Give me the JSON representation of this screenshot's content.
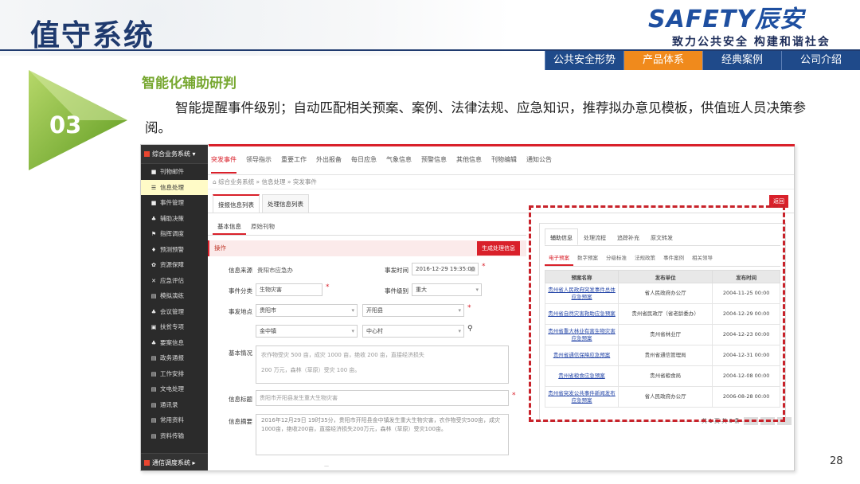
{
  "slide": {
    "title": "值守系统",
    "page_number": "28",
    "logo": {
      "main": "SAFETY辰安",
      "slogan": "致力公共安全 构建和谐社会"
    },
    "nav": [
      {
        "label": "公共安全形势",
        "active": false
      },
      {
        "label": "产品体系",
        "active": true
      },
      {
        "label": "经典案例",
        "active": false
      },
      {
        "label": "公司介绍",
        "active": false
      }
    ],
    "section_number": "03",
    "section_title": "智能化辅助研判",
    "section_desc": "智能提醒事件级别；自动匹配相关预案、案例、法律法规、应急知识，推荐拟办意见模板，供值班人员决策参阅。"
  },
  "app": {
    "sidebar": {
      "header": "综合业务系统",
      "footer": "通信调度系统",
      "items": [
        {
          "icon": "■",
          "label": "刊物邮件",
          "active": false
        },
        {
          "icon": "☰",
          "label": "信息处理",
          "active": true
        },
        {
          "icon": "■",
          "label": "事件管理",
          "active": false
        },
        {
          "icon": "♣",
          "label": "辅助决策",
          "active": false
        },
        {
          "icon": "⚑",
          "label": "指挥调度",
          "active": false
        },
        {
          "icon": "♦",
          "label": "预测预警",
          "active": false
        },
        {
          "icon": "✿",
          "label": "资源保障",
          "active": false
        },
        {
          "icon": "✕",
          "label": "应急评估",
          "active": false
        },
        {
          "icon": "▤",
          "label": "模拟演练",
          "active": false
        },
        {
          "icon": "♣",
          "label": "会议管理",
          "active": false
        },
        {
          "icon": "▣",
          "label": "扶贫专项",
          "active": false
        },
        {
          "icon": "♣",
          "label": "要案信息",
          "active": false
        },
        {
          "icon": "▤",
          "label": "政务通报",
          "active": false
        },
        {
          "icon": "▤",
          "label": "工作安排",
          "active": false
        },
        {
          "icon": "▤",
          "label": "文电处理",
          "active": false
        },
        {
          "icon": "▤",
          "label": "通讯录",
          "active": false
        },
        {
          "icon": "▤",
          "label": "常用资料",
          "active": false
        },
        {
          "icon": "▤",
          "label": "资料传输",
          "active": false
        }
      ]
    },
    "main_tabs": [
      {
        "label": "突发事件",
        "active": true
      },
      {
        "label": "领导指示",
        "active": false
      },
      {
        "label": "重要工作",
        "active": false
      },
      {
        "label": "外出报备",
        "active": false
      },
      {
        "label": "每日应急",
        "active": false
      },
      {
        "label": "气象信息",
        "active": false
      },
      {
        "label": "预警信息",
        "active": false
      },
      {
        "label": "其他信息",
        "active": false
      },
      {
        "label": "刊物编辑",
        "active": false
      },
      {
        "label": "通知公告",
        "active": false
      }
    ],
    "breadcrumb": "综合业务系统 » 信息处理 » 突发事件",
    "subtabs": [
      {
        "label": "接报信息列表",
        "active": true
      },
      {
        "label": "处理信息列表",
        "active": false
      }
    ],
    "return_btn": "返回",
    "info_tabs": [
      {
        "label": "基本信息",
        "active": true
      },
      {
        "label": "原始刊物",
        "active": false
      }
    ],
    "op_label": "操作",
    "generate_btn": "生成处理信息",
    "form": {
      "source_label": "信息来源",
      "source_value": "贵阳市应急办",
      "time_label": "事发时间",
      "time_value": "2016-12-29 19:35:00",
      "category_label": "事件分类",
      "category_value": "生物灾害",
      "level_label": "事件级别",
      "level_value": "重大",
      "location_label": "事发地点",
      "city": "贵阳市",
      "county": "开阳县",
      "town": "金中镇",
      "village": "中心村",
      "situation_label": "基本情况",
      "situation_line1": "农作物受灾 500 亩，成灾 1000 亩，绝收 200 亩，直接经济损失",
      "situation_line2": "200 万元，森林（草原）受灾 100 亩。",
      "title_label": "信息标题",
      "title_value": "贵阳市开阳县发生重大生物灾害",
      "summary_label": "信息摘要",
      "summary_value": "2016年12月29日 19时35分，贵阳市开阳县金中镇发生重大生物灾害，农作物受灾500亩，成灾1000亩，绝收200亩，直接经济损失200万元，森林（草原）受灾100亩。"
    },
    "right": {
      "tabs": [
        {
          "label": "辅助信息",
          "active": true
        },
        {
          "label": "处理流程",
          "active": false
        },
        {
          "label": "追踪补充",
          "active": false
        },
        {
          "label": "原文转发",
          "active": false
        }
      ],
      "subtabs": [
        {
          "label": "电子预案",
          "active": true
        },
        {
          "label": "数字预案",
          "active": false
        },
        {
          "label": "分级标准",
          "active": false
        },
        {
          "label": "法规政策",
          "active": false
        },
        {
          "label": "事件案例",
          "active": false
        },
        {
          "label": "相关领导",
          "active": false
        }
      ],
      "headers": [
        "预案名称",
        "发布单位",
        "发布时间"
      ],
      "rows": [
        {
          "name": "贵州省人民政府突发事件总体应急预案",
          "org": "省人民政府办公厅",
          "date": "2004-11-25 00:00"
        },
        {
          "name": "贵州省自然灾害救助应急预案",
          "org": "贵州省民政厅（省老龄委办）",
          "date": "2004-12-29 00:00"
        },
        {
          "name": "贵州省重大林业有害生物灾害应急预案",
          "org": "贵州省林业厅",
          "date": "2004-12-23 00:00"
        },
        {
          "name": "贵州省通信保障应急预案",
          "org": "贵州省通信管理局",
          "date": "2004-12-31 00:00"
        },
        {
          "name": "贵州省粮食应急预案",
          "org": "贵州省粮食局",
          "date": "2004-12-08 00:00"
        },
        {
          "name": "贵州省突发公共事件新闻发布应急预案",
          "org": "省人民政府办公厅",
          "date": "2006-08-28 00:00"
        }
      ],
      "pager": "共 1 页 共 6 条"
    }
  }
}
